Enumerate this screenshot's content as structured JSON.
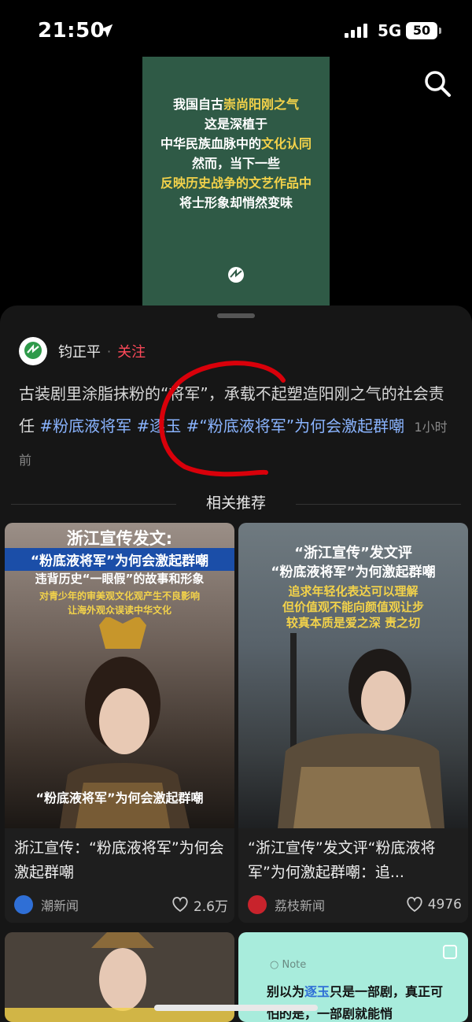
{
  "status_bar": {
    "time": "21:50",
    "network": "5G",
    "battery": "50"
  },
  "hero": {
    "lines": [
      [
        {
          "t": "我国自古"
        },
        {
          "t": "崇尚阳刚之气",
          "hl": true
        }
      ],
      [
        {
          "t": "这是深植于"
        }
      ],
      [
        {
          "t": "中华民族血脉中的"
        },
        {
          "t": "文化认同",
          "hl": true
        }
      ],
      [
        {
          "t": "然而，当下一些"
        }
      ],
      [
        {
          "t": "反映历史战争的文艺作品中",
          "hl": true
        }
      ],
      [
        {
          "t": "将士形象却悄然变味"
        }
      ]
    ],
    "logo_text": "钧正平"
  },
  "post": {
    "author": "钧正平",
    "follow_label": "关注",
    "text": "古装剧里涂脂抹粉的“将军”，承载不起塑造阳刚之气的社会责任",
    "tags": [
      "#粉底液将军",
      "#逐玉",
      "#“粉底液将军”为何会激起群嘲"
    ],
    "time_ago": "1小时前"
  },
  "recommend": {
    "title": "相关推荐"
  },
  "cards": [
    {
      "thumb_heading": "浙江宣传发文:",
      "thumb_banner": "“粉底液将军”为何会激起群嘲",
      "thumb_sub": "违背历史“一眼假”的故事和形象",
      "thumb_sub2": "对青少年的审美观文化观产生不良影响",
      "thumb_sub3": "让海外观众误读中华文化",
      "thumb_bottom": "“粉底液将军”为何会激起群嘲",
      "title": "浙江宣传：“粉底液将军”为何会激起群嘲",
      "source": "潮新闻",
      "likes": "2.6万"
    },
    {
      "thumb_heading": "“浙江宣传”发文评",
      "thumb_banner": "“粉底液将军”为何激起群嘲",
      "thumb_sub": "追求年轻化表达可以理解",
      "thumb_sub2": "但价值观不能向颜值观让步",
      "thumb_sub3": "较真本质是爱之深 责之切",
      "thumb_bottom": "",
      "title": "“浙江宣传”发文评“粉底液将军”为何激起群嘲：追...",
      "source": "荔枝新闻",
      "likes": "4976"
    }
  ],
  "note_card": {
    "label": "Note",
    "text_parts": [
      {
        "t": "别以为"
      },
      {
        "t": "逐玉",
        "hl": true
      },
      {
        "t": "只是一部剧，真正可怕的是，一部剧就能悄"
      }
    ]
  },
  "colors": {
    "accent_follow": "#ff4a5a",
    "tag_blue": "#8ab4ff",
    "hero_bg": "#2f5a46",
    "hero_highlight": "#f3d24a"
  }
}
